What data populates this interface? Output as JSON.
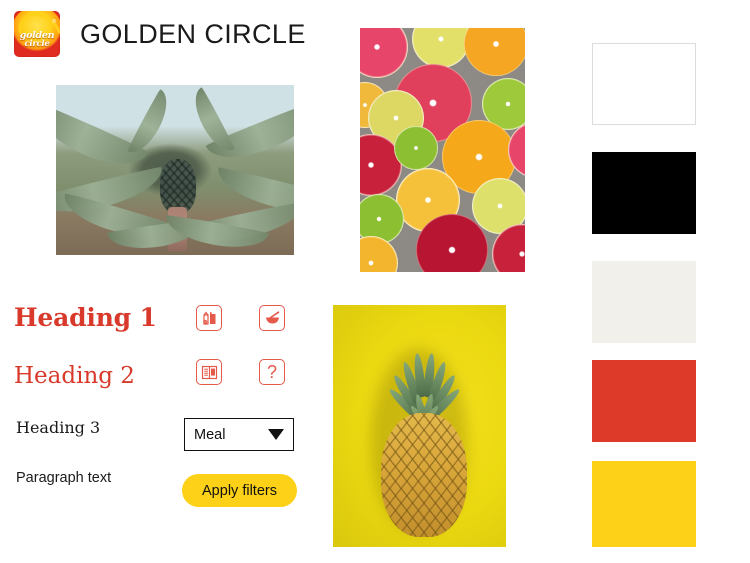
{
  "header": {
    "logo": {
      "icon": "golden-circle-logo",
      "wordmark_line1": "golden",
      "wordmark_line2": "circle",
      "trademark": "®"
    },
    "title": "GOLDEN CIRCLE"
  },
  "photos": [
    {
      "name": "pineapple-field-photo",
      "alt": "Pineapple growing in a field of spiky green plants under a pale blue sky"
    },
    {
      "name": "citrus-slices-photo",
      "alt": "Overhead view of sliced grapefruit, orange, lemon and lime halves on a grey surface"
    },
    {
      "name": "pineapple-yellow-photo",
      "alt": "Whole pineapple centred on a bright yellow background"
    }
  ],
  "typography": {
    "heading_1": "Heading 1",
    "heading_2": "Heading 2",
    "heading_3": "Heading 3",
    "paragraph": "Paragraph text"
  },
  "icons": [
    {
      "name": "juice-carton-icon",
      "label": "Drinks"
    },
    {
      "name": "mortar-pestle-icon",
      "label": "Prepare"
    },
    {
      "name": "recipe-book-icon",
      "label": "Recipes"
    },
    {
      "name": "help-question-icon",
      "label": "?"
    }
  ],
  "controls": {
    "select": {
      "value": "Meal",
      "options": [
        "Meal"
      ],
      "caret": "chevron-down-icon"
    },
    "button": {
      "label": "Apply filters"
    }
  },
  "palette": [
    {
      "name": "white",
      "hex": "#FFFFFF"
    },
    {
      "name": "black",
      "hex": "#000000"
    },
    {
      "name": "cream",
      "hex": "#F2F0EA"
    },
    {
      "name": "red",
      "hex": "#DE3A2A"
    },
    {
      "name": "yellow",
      "hex": "#FCD117"
    }
  ]
}
